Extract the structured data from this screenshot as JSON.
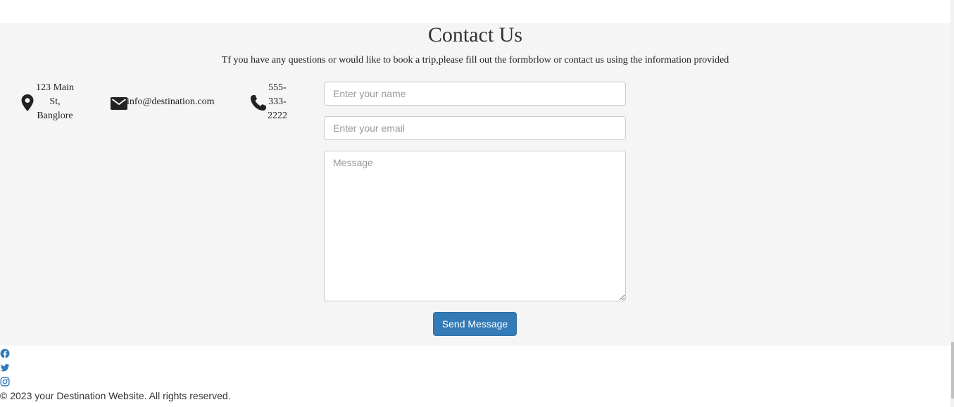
{
  "contact": {
    "title": "Contact Us",
    "subtitle": "Tf you have any questions or would like to book a trip,please fill out the formbrlow or contact us using the information provided",
    "address": "123 Main St, Banglore",
    "email": "info@destination.com",
    "phone": "555-333-2222"
  },
  "form": {
    "name_placeholder": "Enter your name",
    "name_value": "",
    "email_placeholder": "Enter your email",
    "email_value": "",
    "message_placeholder": "Message",
    "message_value": "",
    "send_label": "Send Message"
  },
  "social": {
    "icons": [
      "facebook-icon",
      "twitter-icon",
      "instagram-icon"
    ]
  },
  "footer": {
    "copyright": "© 2023 your Destination Website. All rights reserved."
  },
  "colors": {
    "section_bg": "#f5f5f5",
    "button_bg": "#337ab7",
    "social_blue": "#337ab7",
    "icon_dark": "#222222"
  }
}
